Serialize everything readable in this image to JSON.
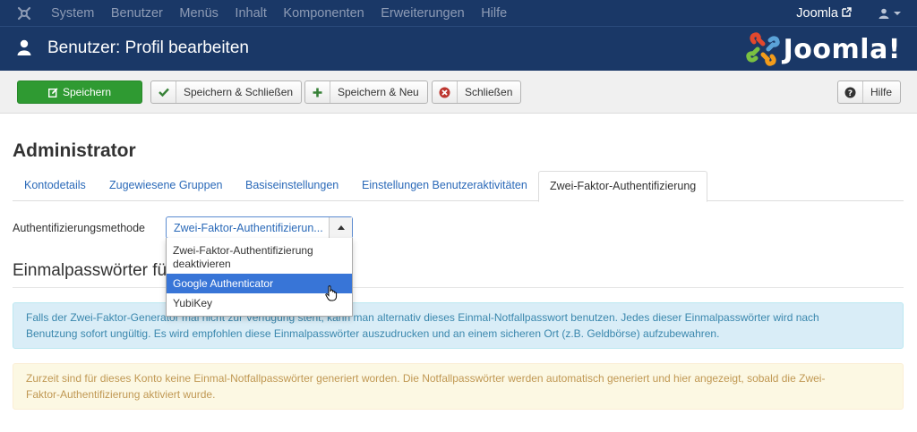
{
  "topnav": {
    "menu": [
      "System",
      "Benutzer",
      "Menüs",
      "Inhalt",
      "Komponenten",
      "Erweiterungen",
      "Hilfe"
    ],
    "site_link": "Joomla"
  },
  "header": {
    "title": "Benutzer: Profil bearbeiten",
    "brand": "Joomla!"
  },
  "toolbar": {
    "save": "Speichern",
    "save_close": "Speichern & Schließen",
    "save_new": "Speichern & Neu",
    "close": "Schließen",
    "help": "Hilfe"
  },
  "page": {
    "heading": "Administrator",
    "tabs": [
      "Kontodetails",
      "Zugewiesene Gruppen",
      "Basiseinstellungen",
      "Einstellungen Benutzeraktivitäten",
      "Zwei-Faktor-Authentifizierung"
    ],
    "active_tab": 4
  },
  "form": {
    "auth_label": "Authentifizierungsmethode",
    "auth_value": "Zwei-Faktor-Authentifizierun...",
    "options": [
      "Zwei-Faktor-Authentifizierung deaktivieren",
      "Google Authenticator",
      "YubiKey"
    ],
    "highlighted_option": 1
  },
  "section": {
    "title": "Einmalpasswörter für"
  },
  "alerts": {
    "info_line1": "Falls der Zwei-Faktor-Generator mal nicht zur Verfügung steht, kann man alternativ dieses Einmal-Notfallpasswort benutzen. Jedes dieser Einmalpasswörter wird nach",
    "info_line2": "Benutzung sofort ungültig. Es wird empfohlen diese Einmalpasswörter auszudrucken und an einem sicheren Ort (z.B. Geldbörse) aufzubewahren.",
    "warning_line1": "Zurzeit sind für dieses Konto keine Einmal-Notfallpasswörter generiert worden. Die Notfallpasswörter werden automatisch generiert und hier angezeigt, sobald die Zwei-",
    "warning_line2": "Faktor-Authentifizierung aktiviert wurde."
  },
  "colors": {
    "nav_bg": "#1a3867",
    "save_green": "#2f9a32",
    "link_blue": "#2a69b8",
    "highlight_blue": "#3875d7"
  }
}
